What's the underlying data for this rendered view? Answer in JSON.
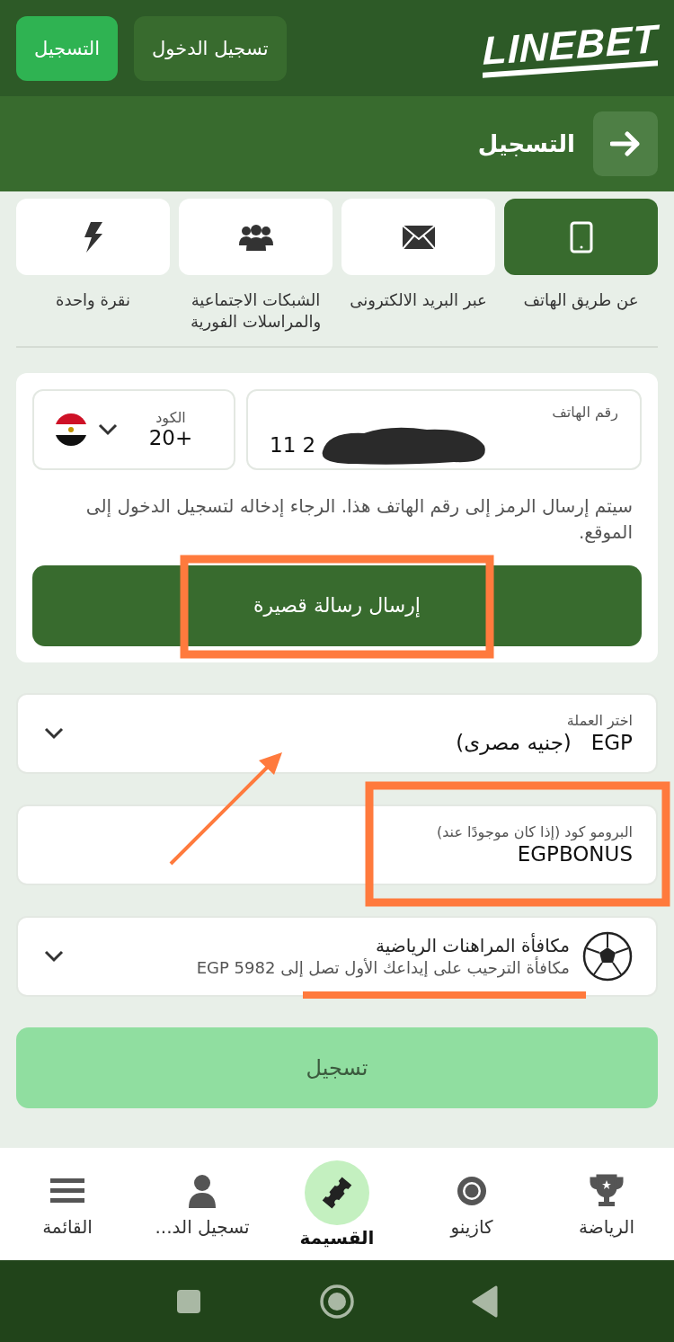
{
  "header": {
    "logo": "LINEBET",
    "buttons": [
      {
        "label": "تسجيل الدخول",
        "kind": "secondary"
      },
      {
        "label": "التسجيل",
        "kind": "primary"
      }
    ]
  },
  "title_bar": {
    "title": "التسجيل"
  },
  "methods": [
    {
      "label": "عن طريق الهاتف",
      "kind": "phone",
      "selected": true
    },
    {
      "label": "عبر البريد الالكترونى",
      "kind": "email",
      "selected": false
    },
    {
      "label": "الشبكات الاجتماعية والمراسلات الفورية",
      "kind": "social",
      "selected": false
    },
    {
      "label": "نقرة واحدة",
      "kind": "flash",
      "selected": false
    }
  ],
  "form": {
    "phone": {
      "label": "رقم الهاتف",
      "value": "11 2"
    },
    "code": {
      "label": "الكود",
      "value": "+20"
    },
    "hint": "سيتم إرسال الرمز إلى رقم الهاتف هذا. الرجاء إدخاله لتسجيل الدخول إلى الموقع.",
    "send_button": "إرسال رسالة قصيرة"
  },
  "currency": {
    "label": "اختر العملة",
    "code": "EGP",
    "name": "(جنيه مصرى)"
  },
  "promo": {
    "label": "البرومو كود (إذا كان موجودًا عند)",
    "value": "EGPBONUS"
  },
  "bonus": {
    "title": "مكافأة المراهنات الرياضية",
    "subtitle": "مكافأة الترحيب على إيداعك الأول تصل إلى EGP 5982"
  },
  "register_button": {
    "label": "تسجيل",
    "disabled": true
  },
  "nav": [
    {
      "label": "الرياضة",
      "kind": "sports",
      "selected": false
    },
    {
      "label": "كازينو",
      "kind": "casino",
      "selected": false
    },
    {
      "label": "القسيمة",
      "kind": "coupon",
      "selected": true
    },
    {
      "label": "تسجيل الد...",
      "kind": "user",
      "selected": false
    },
    {
      "label": "القائمة",
      "kind": "menu",
      "selected": false
    }
  ]
}
